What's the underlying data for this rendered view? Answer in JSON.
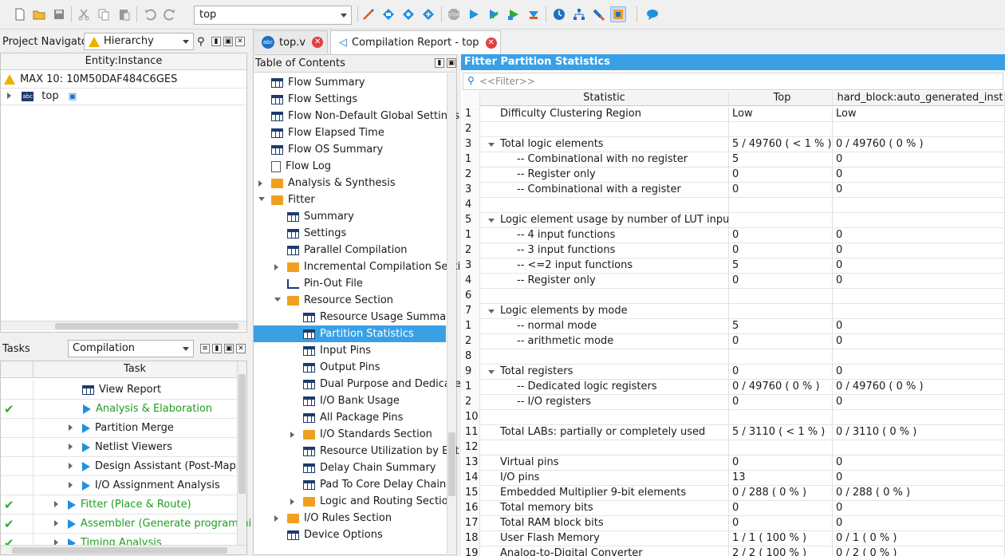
{
  "toolbar": {
    "hierarchy_value": "top"
  },
  "navigator": {
    "label": "Project Navigator",
    "view": "Hierarchy",
    "column": "Entity:Instance",
    "device": "MAX 10: 10M50DAF484C6GES",
    "top": "top"
  },
  "tasks": {
    "label": "Tasks",
    "flow": "Compilation",
    "column": "Task",
    "items": [
      {
        "label": "View Report",
        "done": false
      },
      {
        "label": "Analysis & Elaboration",
        "done": true
      },
      {
        "label": "Partition Merge",
        "done": false
      },
      {
        "label": "Netlist Viewers",
        "done": false
      },
      {
        "label": "Design Assistant (Post-Mappi",
        "done": false
      },
      {
        "label": "I/O Assignment Analysis",
        "done": false
      },
      {
        "label": "Fitter (Place & Route)",
        "done": true
      },
      {
        "label": "Assembler (Generate programmi",
        "done": true
      },
      {
        "label": "Timing Analysis",
        "done": true
      }
    ]
  },
  "tabs": [
    {
      "label": "top.v"
    },
    {
      "label": "Compilation Report - top"
    }
  ],
  "toc": {
    "title": "Table of Contents",
    "items": [
      "Flow Summary",
      "Flow Settings",
      "Flow Non-Default Global Settings",
      "Flow Elapsed Time",
      "Flow OS Summary",
      "Flow Log",
      "Analysis & Synthesis",
      "Fitter",
      "Summary",
      "Settings",
      "Parallel Compilation",
      "Incremental Compilation Secti",
      "Pin-Out File",
      "Resource Section",
      "Resource Usage Summary",
      "Partition Statistics",
      "Input Pins",
      "Output Pins",
      "Dual Purpose and Dedicate",
      "I/O Bank Usage",
      "All Package Pins",
      "I/O Standards Section",
      "Resource Utilization by Ent",
      "Delay Chain Summary",
      "Pad To Core Delay Chain F",
      "Logic and Routing Section",
      "I/O Rules Section",
      "Device Options"
    ]
  },
  "report": {
    "title": "Fitter Partition Statistics",
    "filter_placeholder": "<<Filter>>",
    "columns": [
      "Statistic",
      "Top",
      "hard_block:auto_generated_inst"
    ],
    "rows": [
      [
        "1",
        "Difficulty Clustering Region",
        "Low",
        "Low"
      ],
      [
        "2",
        "",
        "",
        ""
      ],
      [
        "3",
        "Total logic elements",
        "5 / 49760 ( < 1 % )",
        "0 / 49760 ( 0 % )"
      ],
      [
        "1",
        "-- Combinational with no register",
        "5",
        "0"
      ],
      [
        "2",
        "-- Register only",
        "0",
        "0"
      ],
      [
        "3",
        "-- Combinational with a register",
        "0",
        "0"
      ],
      [
        "4",
        "",
        "",
        ""
      ],
      [
        "5",
        "Logic element usage by number of LUT inputs",
        "",
        ""
      ],
      [
        "1",
        "-- 4 input functions",
        "0",
        "0"
      ],
      [
        "2",
        "-- 3 input functions",
        "0",
        "0"
      ],
      [
        "3",
        "-- <=2 input functions",
        "5",
        "0"
      ],
      [
        "4",
        "-- Register only",
        "0",
        "0"
      ],
      [
        "6",
        "",
        "",
        ""
      ],
      [
        "7",
        "Logic elements by mode",
        "",
        ""
      ],
      [
        "1",
        "-- normal mode",
        "5",
        "0"
      ],
      [
        "2",
        "-- arithmetic mode",
        "0",
        "0"
      ],
      [
        "8",
        "",
        "",
        ""
      ],
      [
        "9",
        "Total registers",
        "0",
        "0"
      ],
      [
        "1",
        "-- Dedicated logic registers",
        "0 / 49760 ( 0 % )",
        "0 / 49760 ( 0 % )"
      ],
      [
        "2",
        "-- I/O registers",
        "0",
        "0"
      ],
      [
        "10",
        "",
        "",
        ""
      ],
      [
        "11",
        "Total LABs:  partially or completely used",
        "5 / 3110 ( < 1 % )",
        "0 / 3110 ( 0 % )"
      ],
      [
        "12",
        "",
        "",
        ""
      ],
      [
        "13",
        "Virtual pins",
        "0",
        "0"
      ],
      [
        "14",
        "I/O pins",
        "13",
        "0"
      ],
      [
        "15",
        "Embedded Multiplier 9-bit elements",
        "0 / 288 ( 0 % )",
        "0 / 288 ( 0 % )"
      ],
      [
        "16",
        "Total memory bits",
        "0",
        "0"
      ],
      [
        "17",
        "Total RAM block bits",
        "0",
        "0"
      ],
      [
        "18",
        "User Flash Memory",
        "1 / 1 ( 100 % )",
        "0 / 1 ( 0 % )"
      ],
      [
        "19",
        "Analog-to-Digital Converter",
        "2 / 2 ( 100 % )",
        "0 / 2 ( 0 % )"
      ]
    ]
  }
}
